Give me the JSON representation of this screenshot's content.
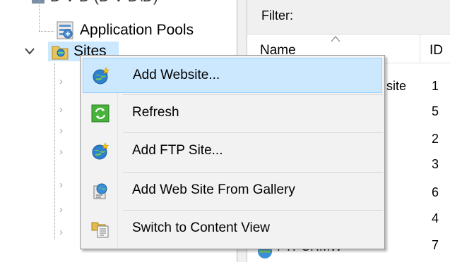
{
  "tree": {
    "top_partial_label": "D V D (D V D\\D)",
    "app_pools_label": "Application Pools",
    "sites_label": "Sites"
  },
  "right_pane": {
    "filter_label": "Filter:",
    "columns": {
      "name": "Name",
      "id": "ID"
    },
    "ids": [
      "1",
      "5",
      "2",
      "3",
      "6",
      "4",
      "7"
    ],
    "partial_name": "site",
    "partial_bottom_name": "FTPCRMWS"
  },
  "context_menu": {
    "items": [
      {
        "label": "Add Website...",
        "icon": "globe-star-icon"
      },
      {
        "label": "Refresh",
        "icon": "refresh-icon"
      },
      {
        "label": "Add FTP Site...",
        "icon": "globe-star-icon"
      },
      {
        "label": "Add Web Site From Gallery",
        "icon": "gallery-icon"
      },
      {
        "label": "Switch to Content View",
        "icon": "content-view-icon"
      }
    ]
  },
  "colors": {
    "menu_highlight": "#cce8ff",
    "menu_highlight_border": "#99d1ff",
    "filter_bar": "#f0f0f0",
    "selected_node": "#cce8ff"
  }
}
